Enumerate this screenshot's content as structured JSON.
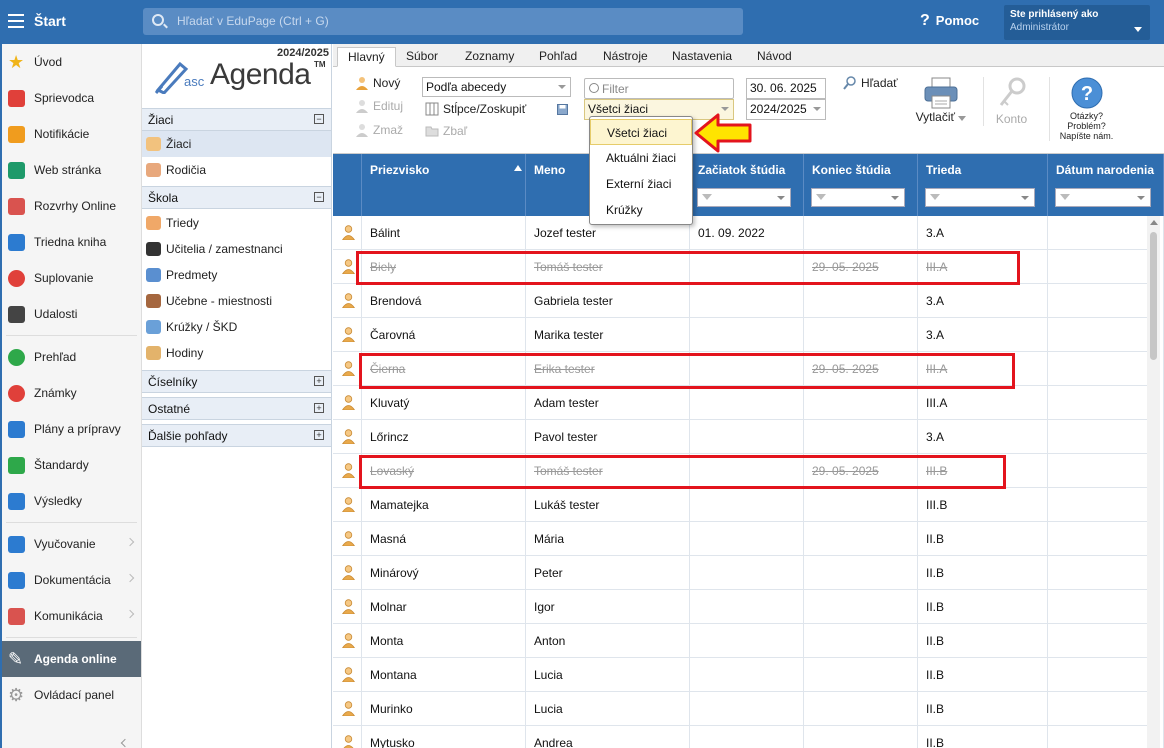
{
  "topbar": {
    "start_label": "Štart",
    "search_placeholder": "Hľadať v EduPage (Ctrl + G)",
    "help_label": "Pomoc",
    "user_line1": "Ste prihlásený ako",
    "user_line2": "Administrátor"
  },
  "leftnav": {
    "items": [
      {
        "label": "Úvod",
        "icon": "star-icon",
        "color": "#f0b419"
      },
      {
        "label": "Sprievodca",
        "icon": "wand-icon",
        "color": "#e0403a"
      },
      {
        "label": "Notifikácie",
        "icon": "envelope-icon",
        "color": "#f09c1e"
      },
      {
        "label": "Web stránka",
        "icon": "home-icon",
        "color": "#1e9a6a"
      },
      {
        "label": "Rozvrhy Online",
        "icon": "timetable-icon",
        "color": "#d9534f"
      },
      {
        "label": "Triedna kniha",
        "icon": "book-icon",
        "color": "#2c7bd0"
      },
      {
        "label": "Suplovanie",
        "icon": "person-icon",
        "color": "#e0403a"
      },
      {
        "label": "Udalosti",
        "icon": "calendar-icon",
        "color": "#444444"
      },
      {
        "label": "Prehľad",
        "icon": "check-circle-icon",
        "color": "#2ea84a"
      },
      {
        "label": "Známky",
        "icon": "grade-icon",
        "color": "#e0403a"
      },
      {
        "label": "Plány a prípravy",
        "icon": "briefcase-icon",
        "color": "#2c7bd0"
      },
      {
        "label": "Štandardy",
        "icon": "shield-icon",
        "color": "#2ea84a"
      },
      {
        "label": "Výsledky",
        "icon": "bar-chart-icon",
        "color": "#2c7bd0"
      },
      {
        "label": "Vyučovanie",
        "icon": "open-book-icon",
        "color": "#2c7bd0"
      },
      {
        "label": "Dokumentácia",
        "icon": "document-icon",
        "color": "#2c7bd0"
      },
      {
        "label": "Komunikácia",
        "icon": "chat-icon",
        "color": "#d9534f"
      },
      {
        "label": "Agenda online",
        "icon": "agenda-icon",
        "color": "#ffffff"
      },
      {
        "label": "Ovládací panel",
        "icon": "gear-icon",
        "color": "#999999"
      }
    ]
  },
  "agenda": {
    "year": "2024/2025",
    "logo_asc": "asc",
    "logo_agenda": "Agenda",
    "logo_tm": "TM",
    "sections": [
      {
        "label": "Žiaci",
        "toggle": "−"
      },
      {
        "label": "Škola",
        "toggle": "−"
      },
      {
        "label": "Číselníky",
        "toggle": "+"
      },
      {
        "label": "Ostatné",
        "toggle": "+"
      },
      {
        "label": "Ďalšie pohľady",
        "toggle": "+"
      }
    ],
    "ziaci_items": [
      "Žiaci",
      "Rodičia"
    ],
    "skola_items": [
      "Triedy",
      "Učitelia / zamestnanci",
      "Predmety",
      "Učebne - miestnosti",
      "Krúžky / ŠKD",
      "Hodiny"
    ]
  },
  "ribbon": {
    "tabs": [
      "Hlavný",
      "Súbor",
      "Zoznamy",
      "Pohľad",
      "Nástroje",
      "Nastavenia",
      "Návod"
    ],
    "new_label": "Nový",
    "edit_label": "Edituj",
    "delete_label": "Zmaž",
    "sort_value": "Podľa abecedy",
    "columns_label": "Stĺpce/Zoskupiť",
    "collapse_label": "Zbaľ",
    "filter_placeholder": "Filter",
    "scope_value": "Všetci žiaci",
    "date_value": "30. 06. 2025",
    "year_value": "2024/2025",
    "find_label": "Hľadať",
    "print_label": "Vytlačiť",
    "account_label": "Konto",
    "help_line1": "Otázky?",
    "help_line2": "Problém?",
    "help_line3": "Napíšte nám."
  },
  "dropdown": {
    "options": [
      "Všetci žiaci",
      "Aktuálni žiaci",
      "Externí žiaci",
      "Krúžky"
    ],
    "highlight_color": "#ffe400"
  },
  "grid": {
    "columns": [
      "Priezvisko",
      "Meno",
      "Začiatok štúdia",
      "Koniec štúdia",
      "Trieda",
      "Dátum narodenia"
    ],
    "rows": [
      {
        "surname": "Bálint",
        "name": "Jozef tester",
        "start": "01. 09. 2022",
        "end": "",
        "class": "3.A",
        "birth": "",
        "ended": false
      },
      {
        "surname": "Biely",
        "name": "Tomáš tester",
        "start": "",
        "end": "29. 05. 2025",
        "class": "III.A",
        "birth": "",
        "ended": true
      },
      {
        "surname": "Brendová",
        "name": "Gabriela tester",
        "start": "",
        "end": "",
        "class": "3.A",
        "birth": "",
        "ended": false
      },
      {
        "surname": "Čarovná",
        "name": "Marika tester",
        "start": "",
        "end": "",
        "class": "3.A",
        "birth": "",
        "ended": false
      },
      {
        "surname": "Čierna",
        "name": "Erika tester",
        "start": "",
        "end": "29. 05. 2025",
        "class": "III.A",
        "birth": "",
        "ended": true
      },
      {
        "surname": "Kluvatý",
        "name": "Adam tester",
        "start": "",
        "end": "",
        "class": "III.A",
        "birth": "",
        "ended": false
      },
      {
        "surname": "Lőrincz",
        "name": "Pavol tester",
        "start": "",
        "end": "",
        "class": "3.A",
        "birth": "",
        "ended": false
      },
      {
        "surname": "Lovaský",
        "name": "Tomáš tester",
        "start": "",
        "end": "29. 05. 2025",
        "class": "III.B",
        "birth": "",
        "ended": true
      },
      {
        "surname": "Mamatejka",
        "name": "Lukáš tester",
        "start": "",
        "end": "",
        "class": "III.B",
        "birth": "",
        "ended": false
      },
      {
        "surname": "Masná",
        "name": "Mária",
        "start": "",
        "end": "",
        "class": "II.B",
        "birth": "",
        "ended": false
      },
      {
        "surname": "Minárový",
        "name": "Peter",
        "start": "",
        "end": "",
        "class": "II.B",
        "birth": "",
        "ended": false
      },
      {
        "surname": "Molnar",
        "name": "Igor",
        "start": "",
        "end": "",
        "class": "II.B",
        "birth": "",
        "ended": false
      },
      {
        "surname": "Monta",
        "name": "Anton",
        "start": "",
        "end": "",
        "class": "II.B",
        "birth": "",
        "ended": false
      },
      {
        "surname": "Montana",
        "name": "Lucia",
        "start": "",
        "end": "",
        "class": "II.B",
        "birth": "",
        "ended": false
      },
      {
        "surname": "Murinko",
        "name": "Lucia",
        "start": "",
        "end": "",
        "class": "II.B",
        "birth": "",
        "ended": false
      },
      {
        "surname": "Mytusko",
        "name": "Andrea",
        "start": "",
        "end": "",
        "class": "II.B",
        "birth": "",
        "ended": false
      }
    ],
    "highlight_box_color": "#e3141d"
  }
}
